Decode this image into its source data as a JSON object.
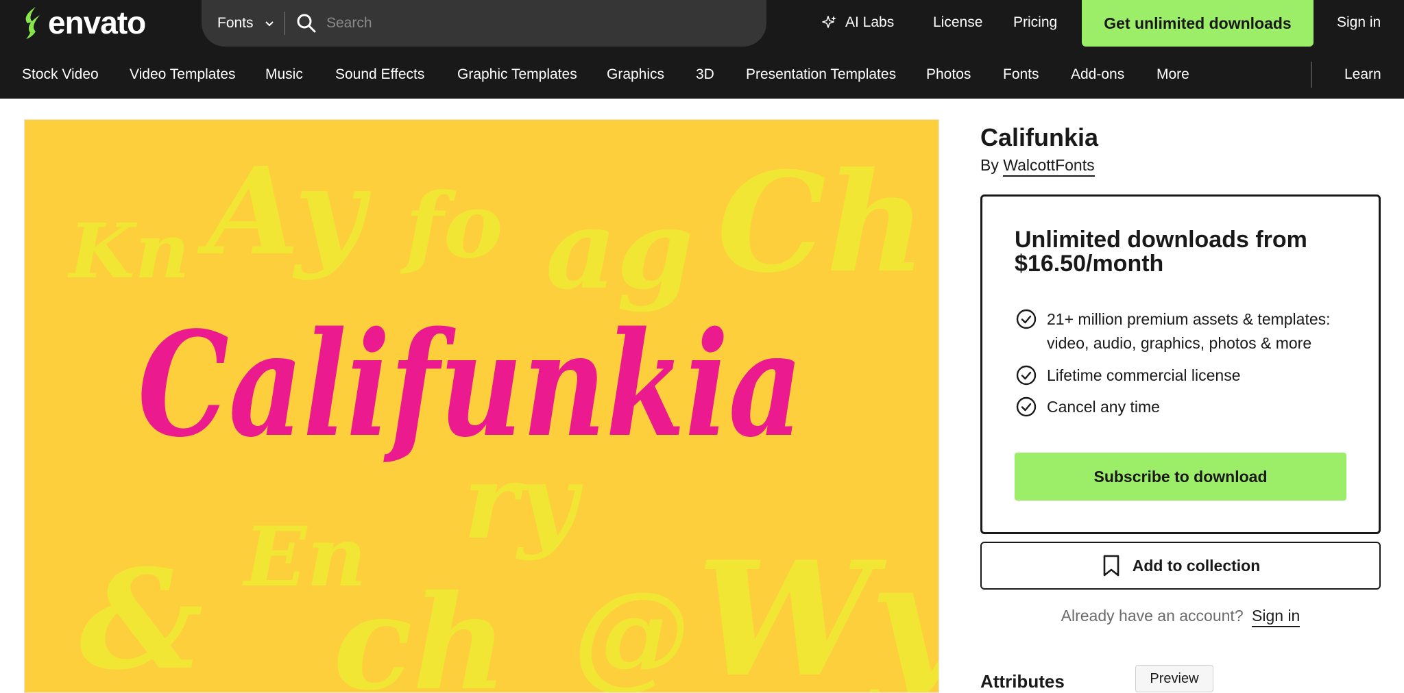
{
  "header": {
    "logo_text": "envato",
    "search_category": "Fonts",
    "search_placeholder": "Search",
    "ai_labs": "AI Labs",
    "license": "License",
    "pricing": "Pricing",
    "cta": "Get unlimited downloads",
    "sign_in": "Sign in"
  },
  "nav": {
    "items": [
      "Stock Video",
      "Video Templates",
      "Music",
      "Sound Effects",
      "Graphic Templates",
      "Graphics",
      "3D",
      "Presentation Templates",
      "Photos",
      "Fonts",
      "Add-ons",
      "More"
    ],
    "learn": "Learn"
  },
  "preview_image": {
    "headline": "Califunkia",
    "glyph_samples": [
      "Kn",
      "Ay",
      "fo",
      "ag",
      "Ch",
      "ry",
      "En",
      "&",
      "ch",
      "@",
      "Wy"
    ],
    "background_color": "#fdcf3c",
    "headline_color": "#ec1a8f",
    "glyph_color": "#f1e634"
  },
  "product": {
    "title": "Califunkia",
    "by_label": "By",
    "author": "WalcottFonts"
  },
  "subscription": {
    "heading": "Unlimited downloads from $16.50/month",
    "benefits": [
      "21+ million premium assets & templates: video, audio, graphics, photos & more",
      "Lifetime commercial license",
      "Cancel any time"
    ],
    "button": "Subscribe to download"
  },
  "collection_button": "Add to collection",
  "account": {
    "prompt": "Already have an account?",
    "sign_in": "Sign in"
  },
  "attributes_heading": "Attributes",
  "preview_tooltip": "Preview",
  "colors": {
    "topbar": "#191919",
    "accent_green": "#9cee69",
    "search_bg": "#363636"
  }
}
